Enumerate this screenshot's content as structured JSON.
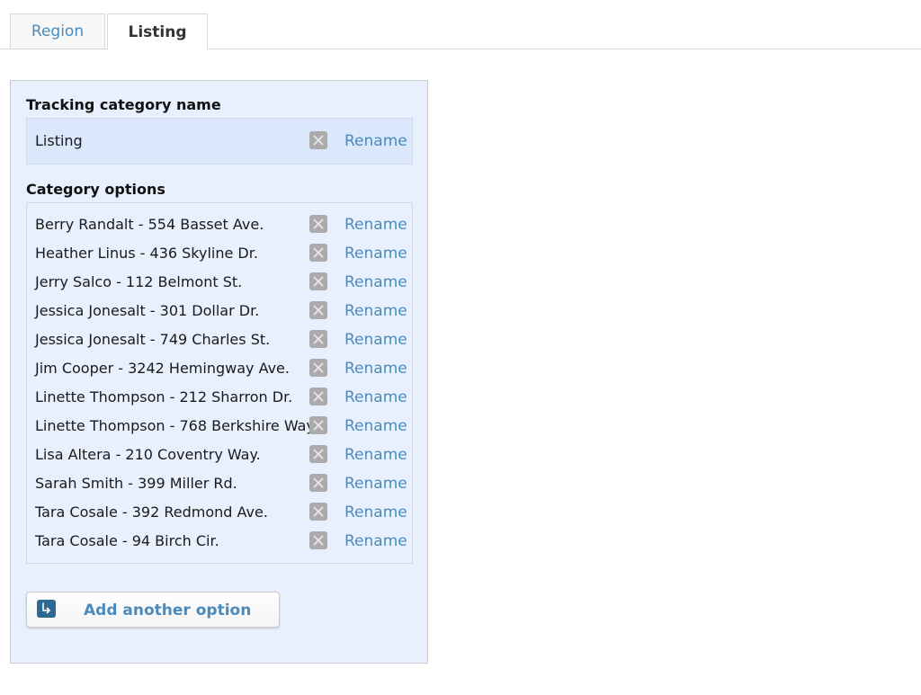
{
  "tabs": [
    {
      "label": "Region",
      "active": false
    },
    {
      "label": "Listing",
      "active": true
    }
  ],
  "tracking_category": {
    "title": "Tracking category name",
    "name": "Listing",
    "delete_icon": "close-x-icon",
    "rename_label": "Rename"
  },
  "category_options": {
    "title": "Category options",
    "delete_icon": "close-x-icon",
    "items": [
      {
        "label": "Berry Randalt - 554 Basset Ave.",
        "rename_label": "Rename"
      },
      {
        "label": "Heather Linus - 436 Skyline Dr.",
        "rename_label": "Rename"
      },
      {
        "label": "Jerry Salco - 112 Belmont St.",
        "rename_label": "Rename"
      },
      {
        "label": "Jessica Jonesalt - 301 Dollar Dr.",
        "rename_label": "Rename"
      },
      {
        "label": "Jessica Jonesalt - 749 Charles St.",
        "rename_label": "Rename"
      },
      {
        "label": "Jim Cooper - 3242 Hemingway Ave.",
        "rename_label": "Rename"
      },
      {
        "label": "Linette Thompson - 212 Sharron Dr.",
        "rename_label": "Rename"
      },
      {
        "label": "Linette Thompson - 768 Berkshire Way.",
        "rename_label": "Rename"
      },
      {
        "label": "Lisa Altera - 210 Coventry Way.",
        "rename_label": "Rename"
      },
      {
        "label": "Sarah Smith - 399 Miller Rd.",
        "rename_label": "Rename"
      },
      {
        "label": "Tara Cosale - 392 Redmond Ave.",
        "rename_label": "Rename"
      },
      {
        "label": "Tara Cosale - 94 Birch Cir.",
        "rename_label": "Rename"
      }
    ]
  },
  "add_button": {
    "label": "Add another option",
    "icon": "return-arrow-icon"
  },
  "colors": {
    "link": "#4a8bbd",
    "panel_bg": "#e8f0fd",
    "name_box_bg": "#dbe7fb",
    "delete_icon_bg": "#ababab",
    "add_icon_bg": "#2d6a93"
  }
}
